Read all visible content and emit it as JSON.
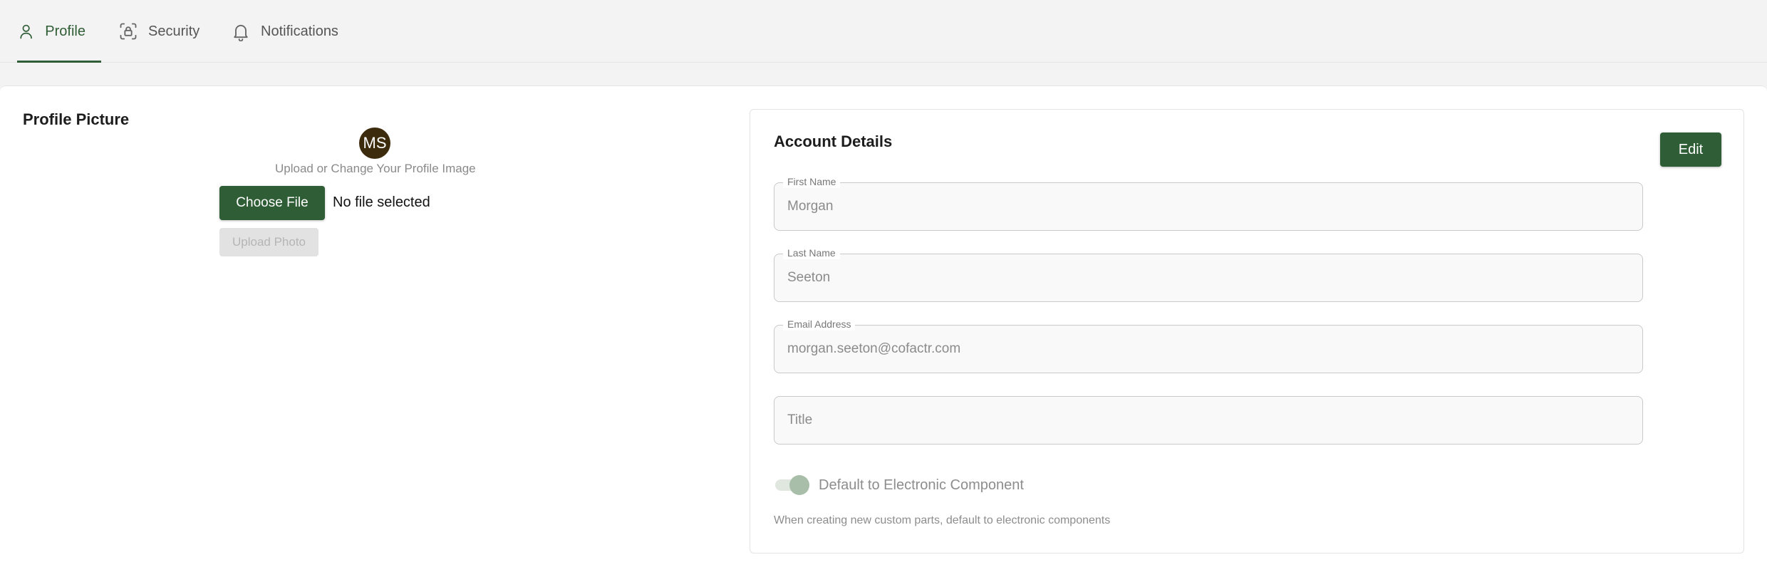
{
  "tabs": [
    {
      "label": "Profile",
      "icon": "user-icon",
      "active": true
    },
    {
      "label": "Security",
      "icon": "face-lock-icon",
      "active": false
    },
    {
      "label": "Notifications",
      "icon": "bell-icon",
      "active": false
    }
  ],
  "profile_picture": {
    "title": "Profile Picture",
    "initials": "MS",
    "hint": "Upload or Change Your Profile Image",
    "choose_label": "Choose File",
    "no_file_text": "No file selected",
    "upload_label": "Upload Photo"
  },
  "account": {
    "title": "Account Details",
    "edit_label": "Edit",
    "fields": {
      "first": {
        "label": "First Name",
        "value": "Morgan"
      },
      "last": {
        "label": "Last Name",
        "value": "Seeton"
      },
      "email": {
        "label": "Email Address",
        "value": "morgan.seeton@cofactr.com"
      },
      "title": {
        "placeholder": "Title"
      }
    },
    "toggle_label": "Default to Electronic Component",
    "toggle_on": true,
    "helper": "When creating new custom parts, default to electronic components"
  },
  "colors": {
    "accent": "#2f5d35",
    "avatar_bg": "#3d2b0d"
  }
}
